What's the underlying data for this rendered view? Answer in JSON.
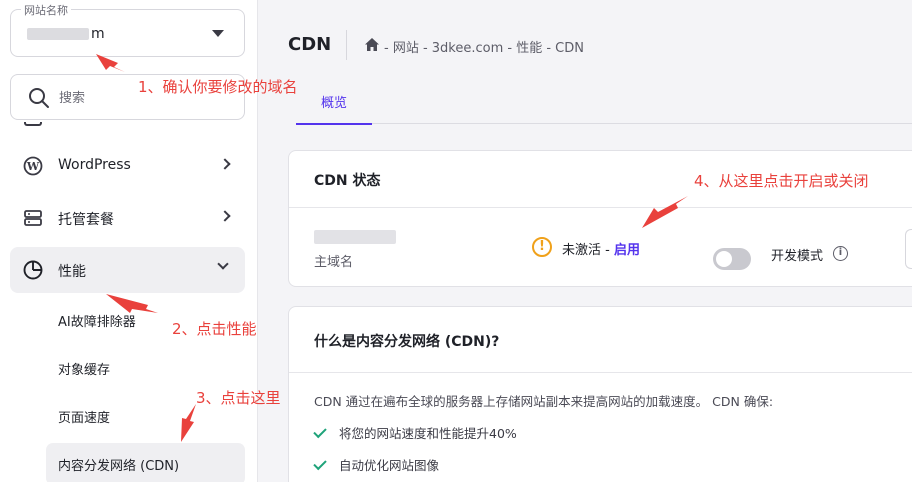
{
  "sidebar": {
    "site_select": {
      "label": "网站名称",
      "value_suffix": "m"
    },
    "search": {
      "placeholder": "搜索"
    },
    "items": [
      {
        "label": "WordPress"
      },
      {
        "label": "托管套餐"
      },
      {
        "label": "性能"
      }
    ],
    "sub_items": [
      {
        "label": "AI故障排除器"
      },
      {
        "label": "对象缓存"
      },
      {
        "label": "页面速度"
      },
      {
        "label": "内容分发网络 (CDN)"
      }
    ]
  },
  "header": {
    "title": "CDN",
    "breadcrumb": "- 网站 - 3dkee.com - 性能 - CDN"
  },
  "tabs": [
    {
      "label": "概览"
    }
  ],
  "cdn_status_card": {
    "title": "CDN 状态",
    "domain_label": "主域名",
    "status_text": "未激活",
    "status_sep": " - ",
    "enable_label": "启用",
    "dev_mode_label": "开发模式",
    "warning_glyph": "!",
    "info_glyph": "i"
  },
  "what_is_card": {
    "title": "什么是内容分发网络 (CDN)?",
    "description": "CDN 通过在遍布全球的服务器上存储网站副本来提高网站的加载速度。 CDN 确保:",
    "benefits": [
      "将您的网站速度和性能提升40%",
      "自动优化网站图像"
    ]
  },
  "annotations": {
    "step1": "1、确认你要修改的域名",
    "step2": "2、点击性能",
    "step3": "3、点击这里",
    "step4": "4、从这里点击开启或关闭"
  },
  "colors": {
    "accent": "#5333ed",
    "warning": "#f0a11a",
    "success": "#1fa37a",
    "annotation": "#e9413c"
  }
}
